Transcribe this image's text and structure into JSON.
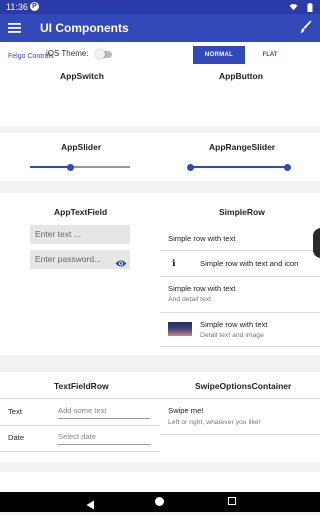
{
  "status_bar": {
    "time": "11:36",
    "badge": "P"
  },
  "app_bar": {
    "title": "UI Components"
  },
  "section_link": "Felgo Controls",
  "app_switch": {
    "heading": "AppSwitch",
    "label": "iOS Theme:",
    "checked": false
  },
  "app_button": {
    "heading": "AppButton",
    "normal_label": "NORMAL",
    "flat_label": "FLAT"
  },
  "app_slider": {
    "heading": "AppSlider",
    "value": 0.4
  },
  "app_range_slider": {
    "heading": "AppRangeSlider",
    "low": 0.0,
    "high": 1.0
  },
  "app_text_field": {
    "heading": "AppTextField",
    "text_placeholder": "Enter text ...",
    "password_placeholder": "Enter password..."
  },
  "simple_row": {
    "heading": "SimpleRow",
    "rows": [
      {
        "text": "Simple row with text",
        "detail": ""
      },
      {
        "text": "Simple row with text and icon",
        "detail": ""
      },
      {
        "text": "Simple row with text",
        "detail": "And detail text"
      },
      {
        "text": "Simple row with text",
        "detail": "Detail text and image"
      }
    ]
  },
  "text_field_row": {
    "heading": "TextFieldRow",
    "rows": [
      {
        "label": "Text",
        "placeholder": "Add some text"
      },
      {
        "label": "Date",
        "placeholder": "Select date"
      }
    ]
  },
  "swipe_options": {
    "heading": "SwipeOptionsContainer",
    "title": "Swipe me!",
    "subtitle": "Left or right, whatever you like!"
  },
  "colors": {
    "primary": "#3249b7",
    "status_bar": "#2a3aa6"
  }
}
